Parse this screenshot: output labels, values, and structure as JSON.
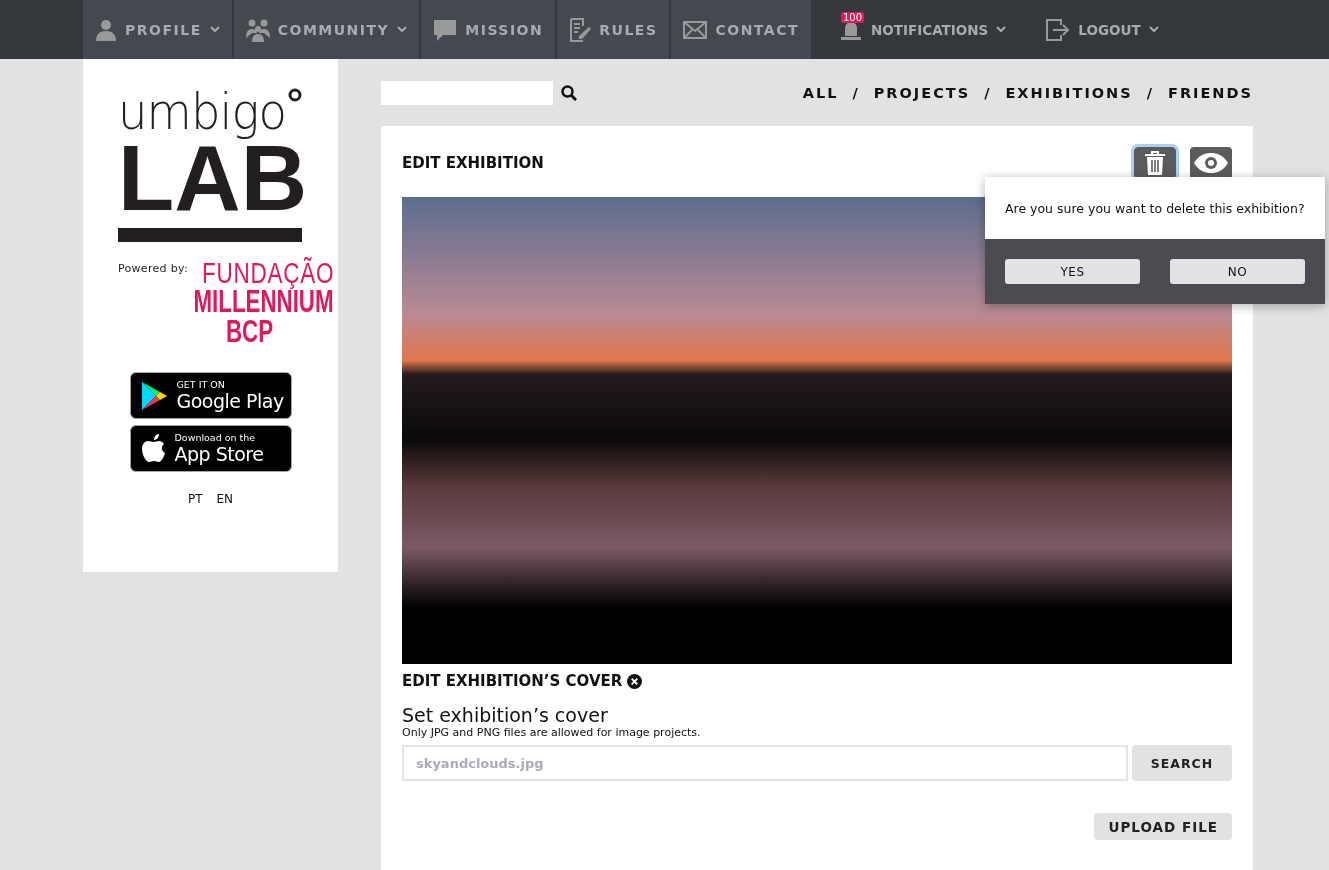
{
  "nav": {
    "items": [
      {
        "label": "PROFILE",
        "kind": "tile",
        "has_menu": true
      },
      {
        "label": "COMMUNITY",
        "kind": "tile",
        "has_menu": true
      },
      {
        "label": "MISSION",
        "kind": "tile",
        "has_menu": false
      },
      {
        "label": "RULES",
        "kind": "tile",
        "has_menu": false
      },
      {
        "label": "CONTACT",
        "kind": "tile",
        "has_menu": false
      },
      {
        "label": "NOTIFICATIONS",
        "kind": "plain",
        "has_menu": true,
        "badge": "100"
      },
      {
        "label": "LOGOUT",
        "kind": "plain",
        "has_menu": true
      }
    ]
  },
  "sidebar": {
    "logo_top": "umbigo",
    "logo_bottom": "LAB",
    "powered_by": "Powered by:",
    "sponsor": [
      "FUNDAÇÃO",
      "MILLENNIUM",
      "BCP"
    ],
    "store_badges": [
      {
        "kind": "google",
        "small": "GET IT ON",
        "big": "Google Play"
      },
      {
        "kind": "apple",
        "small": "Download on the",
        "big": "App Store"
      }
    ],
    "languages": [
      "PT",
      "EN"
    ]
  },
  "filters": [
    {
      "label": "ALL"
    },
    {
      "separator": "/",
      "label": "PROJECTS"
    },
    {
      "separator": "/",
      "label": "EXHIBITIONS"
    },
    {
      "separator": "/",
      "label": "FRIENDS"
    }
  ],
  "editor": {
    "title": "EDIT EXHIBITION",
    "cover_title": "EDIT EXHIBITION’S COVER",
    "set_cover": "Set exhibition’s cover",
    "hint": "Only JPG and PNG files are allowed for image projects.",
    "file_value": "skyandclouds.jpg",
    "search_button": "SEARCH",
    "upload_button": "UPLOAD FILE"
  },
  "confirm": {
    "message": "Are you sure you want to delete this exhibition?",
    "buttons": [
      "YES",
      "NO"
    ]
  }
}
